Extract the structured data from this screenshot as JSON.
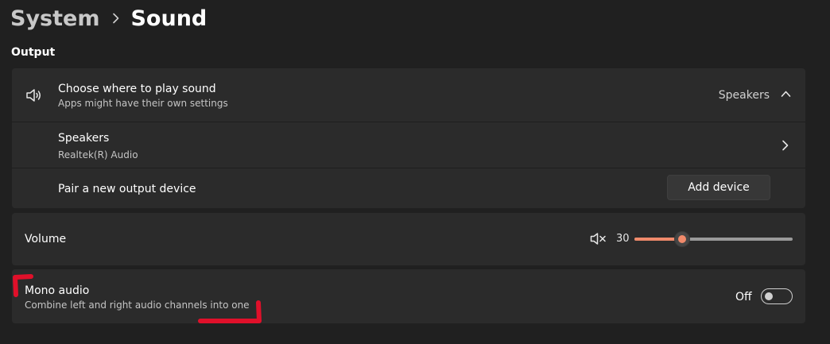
{
  "breadcrumb": {
    "parent": "System",
    "current": "Sound"
  },
  "output": {
    "section_title": "Output",
    "choose": {
      "title": "Choose where to play sound",
      "subtitle": "Apps might have their own settings",
      "value": "Speakers",
      "icon": "speaker-icon",
      "expand_icon": "chevron-up-icon"
    },
    "speakers": {
      "title": "Speakers",
      "subtitle": "Realtek(R) Audio",
      "nav_icon": "chevron-right-icon"
    },
    "pair": {
      "title": "Pair a new output device",
      "button_label": "Add device"
    }
  },
  "volume": {
    "title": "Volume",
    "value_label": "30",
    "value_percent": 30,
    "mute_icon": "volume-mute-icon"
  },
  "mono": {
    "title": "Mono audio",
    "subtitle": "Combine left and right audio channels into one",
    "state_label": "Off",
    "enabled": false
  },
  "colors": {
    "background": "#202020",
    "card": "#2b2b2b",
    "accent": "#f08a6b",
    "annotation": "#e0102a"
  }
}
